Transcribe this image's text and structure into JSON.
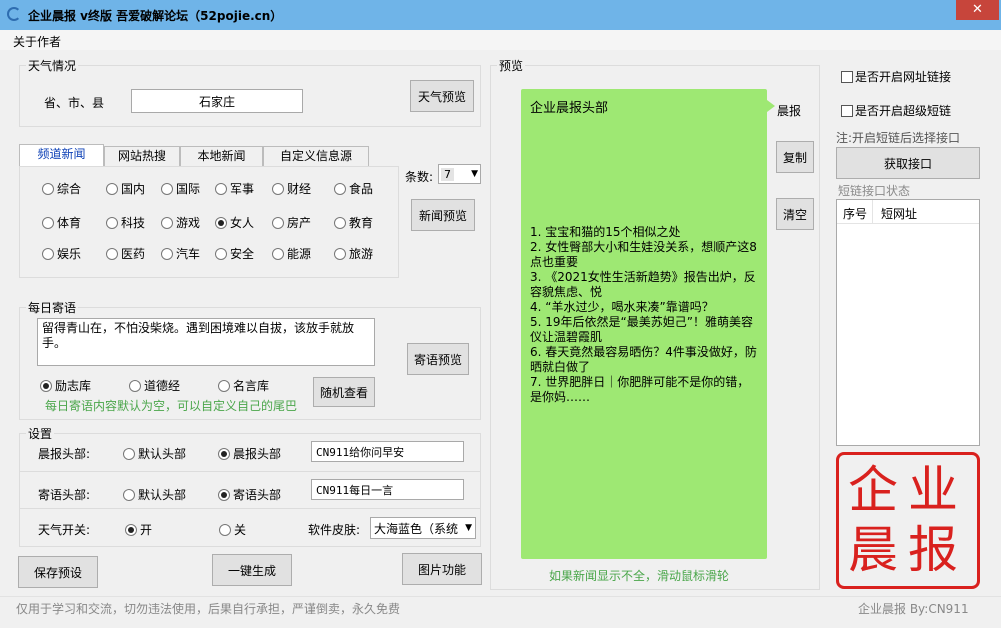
{
  "window": {
    "title": "企业晨报 v终版 吾爱破解论坛（52pojie.cn）",
    "close_label": "✕"
  },
  "menu": {
    "about": "关于作者"
  },
  "weather": {
    "legend": "天气情况",
    "location_label": "省、市、县",
    "location_value": "石家庄",
    "preview_button": "天气预览"
  },
  "tabs": [
    "频道新闻",
    "网站热搜",
    "本地新闻",
    "自定义信息源"
  ],
  "channels": {
    "row1": [
      "综合",
      "国内",
      "国际",
      "军事",
      "财经",
      "食品"
    ],
    "row2": [
      "体育",
      "科技",
      "游戏",
      "女人",
      "房产",
      "教育"
    ],
    "row3": [
      "娱乐",
      "医药",
      "汽车",
      "安全",
      "能源",
      "旅游"
    ],
    "selected": "女人"
  },
  "count": {
    "label": "条数:",
    "value": "7"
  },
  "news_preview_button": "新闻预览",
  "daily": {
    "legend": "每日寄语",
    "text": "留得青山在，不怕没柴烧。遇到困境难以自拔，该放手就放手。",
    "preview_button": "寄语预览",
    "options": [
      "励志库",
      "道德经",
      "名言库"
    ],
    "selected": "励志库",
    "random_button": "随机查看",
    "hint": "每日寄语内容默认为空，可以自定义自己的尾巴"
  },
  "settings": {
    "legend": "设置",
    "morning_header_label": "晨报头部:",
    "morning_options": [
      "默认头部",
      "晨报头部"
    ],
    "morning_selected": "晨报头部",
    "morning_value": "CN911给你问早安",
    "daily_header_label": "寄语头部:",
    "daily_options": [
      "默认头部",
      "寄语头部"
    ],
    "daily_selected": "寄语头部",
    "daily_value": "CN911每日一言",
    "weather_switch_label": "天气开关:",
    "weather_on": "开",
    "weather_off": "关",
    "weather_selected": "开",
    "skin_label": "软件皮肤:",
    "skin_value": "大海蓝色（系统"
  },
  "buttons": {
    "save": "保存预设",
    "generate": "一键生成",
    "image": "图片功能",
    "morning": "晨报",
    "copy": "复制",
    "clear": "清空",
    "get_api": "获取接口"
  },
  "preview": {
    "legend": "预览",
    "header": "企业晨报头部",
    "news": [
      "1. 宝宝和猫的15个相似之处",
      "2. 女性臀部大小和生娃没关系，想顺产这8点也重要",
      "3. 《2021女性生活新趋势》报告出炉，反容貌焦虑、悦",
      "4. “羊水过少，喝水来凑”靠谱吗？",
      "5. 19年后依然是“最美苏妲己”！雅萌美容仪让温碧霞肌",
      "6. 春天竟然最容易晒伤？4件事没做好，防晒就白做了",
      "7. 世界肥胖日｜你肥胖可能不是你的错，是你妈……"
    ],
    "scroll_hint": "如果新闻显示不全，滑动鼠标滑轮"
  },
  "right": {
    "url_link": "是否开启网址链接",
    "super_link": "是否开启超级短链",
    "note": "注:开启短链后选择接口",
    "status_label": "短链接口状态",
    "col_index": "序号",
    "col_url": "短网址"
  },
  "logo": {
    "chars": [
      "企",
      "业",
      "晨",
      "报"
    ]
  },
  "footer": {
    "disclaimer": "仅用于学习和交流，切勿违法使用，后果自行承担，严谨倒卖，永久免费",
    "credit": "企业晨报 By:CN911"
  },
  "colors": {
    "titlebar": "#6fb4e8",
    "bubble": "#9ee873",
    "accent_green": "#4aa64a",
    "seal_red": "#d9211e"
  }
}
